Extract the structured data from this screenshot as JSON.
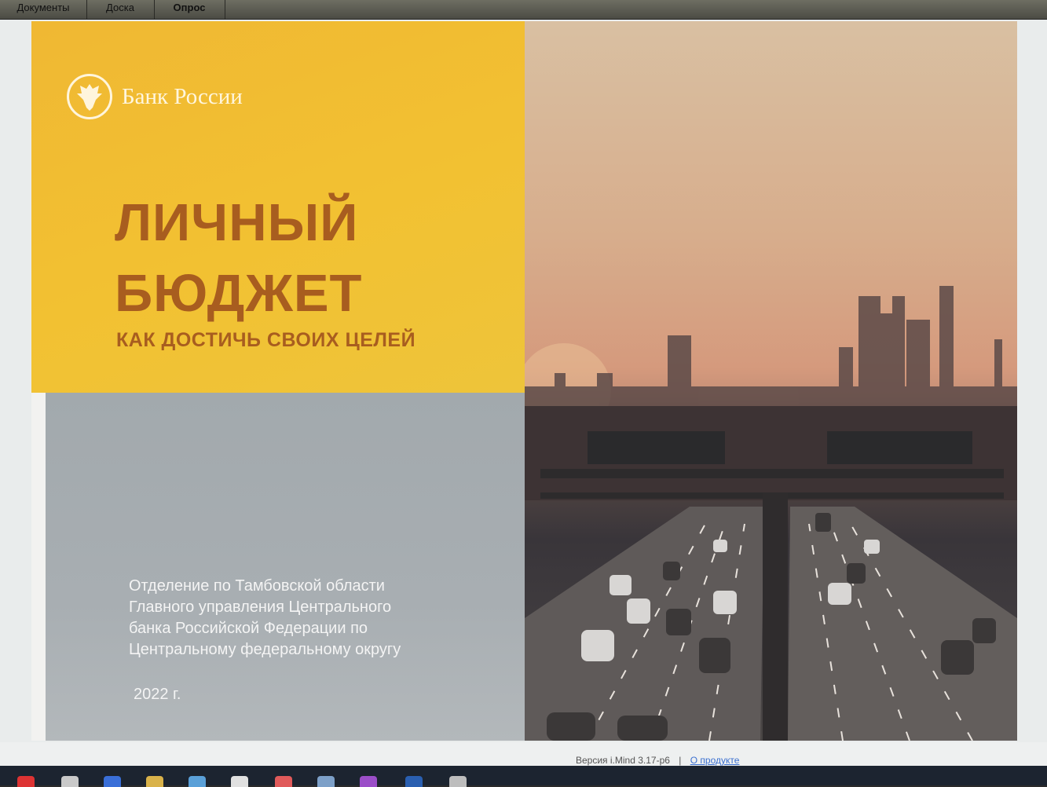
{
  "top_tabs": [
    {
      "label": "Документы",
      "active": false
    },
    {
      "label": "Доска",
      "active": false
    },
    {
      "label": "Опрос",
      "active": true
    }
  ],
  "slide": {
    "logo_text": "Банк России",
    "title_line1": "ЛИЧНЫЙ",
    "title_line2": "БЮДЖЕТ",
    "subtitle": "КАК ДОСТИЧЬ СВОИХ ЦЕЛЕЙ",
    "org_lines": [
      "Отделение по Тамбовской области",
      "Главного управления Центрального",
      "банка Российской Федерации по",
      "Центральному федеральному округу"
    ],
    "year": "2022 г."
  },
  "status": {
    "version": "Версия i.Mind 3.17-р6",
    "separator": "|",
    "about_link": "О продукте"
  },
  "colors": {
    "accent_yellow": "#f2c132",
    "title_brown": "#a85d1f",
    "panel_grey": "#a5acb0"
  }
}
